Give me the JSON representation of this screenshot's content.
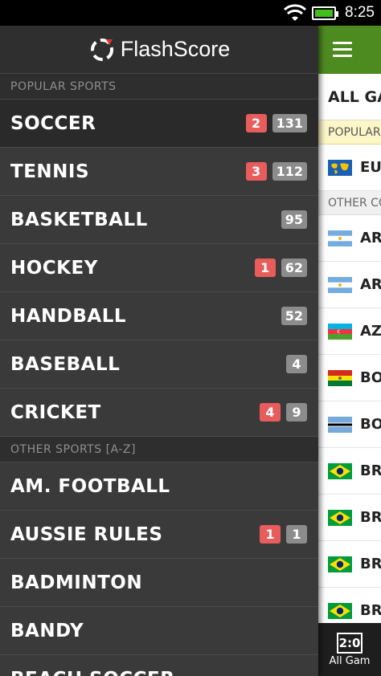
{
  "status_bar": {
    "time": "8:25",
    "icons": [
      "wifi-icon",
      "battery-icon"
    ],
    "battery_color": "#41c01a"
  },
  "drawer": {
    "app_name": "FlashScore",
    "popular_heading": "POPULAR SPORTS",
    "popular": [
      {
        "label": "SOCCER",
        "live": "2",
        "total": "131"
      },
      {
        "label": "TENNIS",
        "live": "3",
        "total": "112"
      },
      {
        "label": "BASKETBALL",
        "live": "",
        "total": "95"
      },
      {
        "label": "HOCKEY",
        "live": "1",
        "total": "62"
      },
      {
        "label": "HANDBALL",
        "live": "",
        "total": "52"
      },
      {
        "label": "BASEBALL",
        "live": "",
        "total": "4"
      },
      {
        "label": "CRICKET",
        "live": "4",
        "total": "9"
      }
    ],
    "other_heading": "OTHER SPORTS [A-Z]",
    "other": [
      {
        "label": "AM. FOOTBALL",
        "live": "",
        "total": ""
      },
      {
        "label": "AUSSIE RULES",
        "live": "1",
        "total": "1"
      },
      {
        "label": "BADMINTON",
        "live": "",
        "total": ""
      },
      {
        "label": "BANDY",
        "live": "",
        "total": ""
      },
      {
        "label": "BEACH SOCCER",
        "live": "",
        "total": ""
      }
    ]
  },
  "main": {
    "all_games": "ALL GA",
    "popular_heading": "POPULAR",
    "popular_rows": [
      {
        "flag": "world",
        "text": "EU"
      }
    ],
    "other_heading": "OTHER CO",
    "country_rows": [
      {
        "flag": "argentina",
        "text": "AR"
      },
      {
        "flag": "argentina",
        "text": "AR"
      },
      {
        "flag": "azerbaijan",
        "text": "AZ"
      },
      {
        "flag": "bolivia",
        "text": "BO"
      },
      {
        "flag": "botswana",
        "text": "BO"
      },
      {
        "flag": "brazil",
        "text": "BR"
      },
      {
        "flag": "brazil",
        "text": "BR"
      },
      {
        "flag": "brazil",
        "text": "BR"
      },
      {
        "flag": "brazil",
        "text": "BR"
      }
    ],
    "bottom_tab": {
      "icon_text": "2:0",
      "label": "All Gam"
    }
  },
  "colors": {
    "accent_green": "#4d8a1f",
    "live_badge": "#e85c5c",
    "total_badge": "#8c8c8c",
    "logo_red": "#e8322b"
  }
}
